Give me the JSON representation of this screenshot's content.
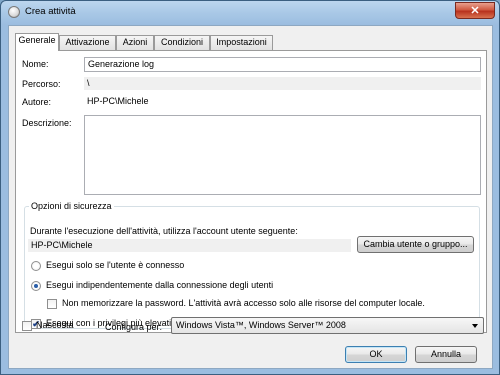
{
  "window": {
    "title": "Crea attività",
    "close_glyph": "✕"
  },
  "tabs": [
    {
      "label": "Generale",
      "active": true
    },
    {
      "label": "Attivazione",
      "active": false
    },
    {
      "label": "Azioni",
      "active": false
    },
    {
      "label": "Condizioni",
      "active": false
    },
    {
      "label": "Impostazioni",
      "active": false
    }
  ],
  "general": {
    "name_label": "Nome:",
    "name_value": "Generazione log",
    "path_label": "Percorso:",
    "path_value": "\\",
    "author_label": "Autore:",
    "author_value": "HP-PC\\Michele",
    "description_label": "Descrizione:",
    "description_value": ""
  },
  "security": {
    "legend": "Opzioni di sicurezza",
    "account_prompt": "Durante l'esecuzione dell'attività, utilizza l'account utente seguente:",
    "account_value": "HP-PC\\Michele",
    "change_user_button": "Cambia utente o gruppo...",
    "radio_logged_on": {
      "label": "Esegui solo se l'utente è connesso",
      "checked": false
    },
    "radio_independent": {
      "label": "Esegui indipendentemente dalla connessione degli utenti",
      "checked": true
    },
    "no_store_password": {
      "label": "Non memorizzare la password. L'attività avrà accesso solo alle risorse del computer locale.",
      "checked": false
    },
    "highest_privileges": {
      "label": "Esegui con i privilegi più elevati",
      "checked": true
    }
  },
  "footer": {
    "hidden_label": "Nascosta",
    "hidden_checked": false,
    "configure_label": "Configura per:",
    "configure_value": "Windows Vista™, Windows Server™ 2008",
    "ok_button": "OK",
    "cancel_button": "Annulla"
  },
  "icons": {
    "window_icon": "task-scheduler-icon",
    "close": "close-icon",
    "dropdown": "chevron-down-icon"
  }
}
